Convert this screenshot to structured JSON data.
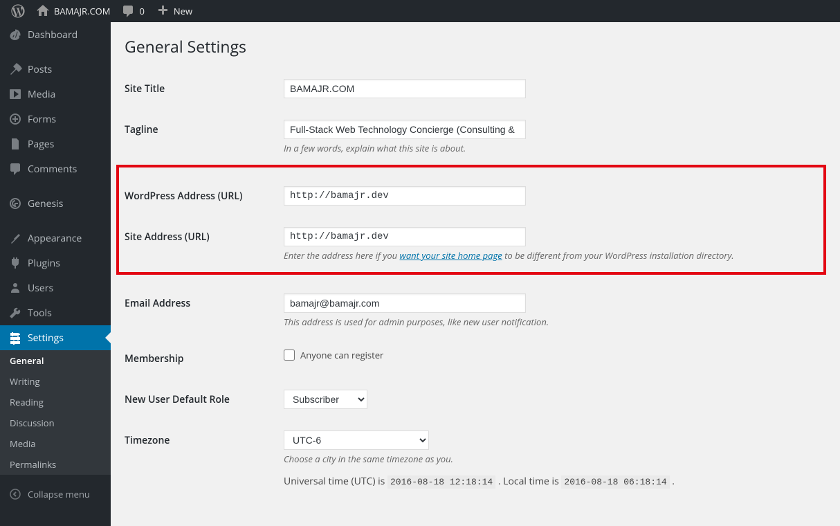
{
  "adminbar": {
    "site_name": "BAMAJR.COM",
    "comments_count": "0",
    "new_label": "New"
  },
  "sidebar": {
    "items": [
      {
        "label": "Dashboard"
      },
      {
        "label": "Posts"
      },
      {
        "label": "Media"
      },
      {
        "label": "Forms"
      },
      {
        "label": "Pages"
      },
      {
        "label": "Comments"
      },
      {
        "label": "Genesis"
      },
      {
        "label": "Appearance"
      },
      {
        "label": "Plugins"
      },
      {
        "label": "Users"
      },
      {
        "label": "Tools"
      },
      {
        "label": "Settings"
      }
    ],
    "submenu": [
      {
        "label": "General"
      },
      {
        "label": "Writing"
      },
      {
        "label": "Reading"
      },
      {
        "label": "Discussion"
      },
      {
        "label": "Media"
      },
      {
        "label": "Permalinks"
      }
    ],
    "collapse_label": "Collapse menu"
  },
  "page": {
    "title": "General Settings"
  },
  "fields": {
    "site_title": {
      "label": "Site Title",
      "value": "BAMAJR.COM"
    },
    "tagline": {
      "label": "Tagline",
      "value": "Full-Stack Web Technology Concierge (Consulting &",
      "desc": "In a few words, explain what this site is about."
    },
    "wp_url": {
      "label": "WordPress Address (URL)",
      "value": "http://bamajr.dev"
    },
    "site_url": {
      "label": "Site Address (URL)",
      "value": "http://bamajr.dev",
      "desc_pre": "Enter the address here if you ",
      "desc_link": "want your site home page",
      "desc_post": " to be different from your WordPress installation directory."
    },
    "email": {
      "label": "Email Address",
      "value": "bamajr@bamajr.com",
      "desc": "This address is used for admin purposes, like new user notification."
    },
    "membership": {
      "label": "Membership",
      "checkbox_label": "Anyone can register"
    },
    "default_role": {
      "label": "New User Default Role",
      "value": "Subscriber"
    },
    "timezone": {
      "label": "Timezone",
      "value": "UTC-6",
      "desc": "Choose a city in the same timezone as you.",
      "utc_pre": "Universal time (UTC) is ",
      "utc_time": "2016-08-18 12:18:14",
      "local_pre": " . Local time is ",
      "local_time": "2016-08-18 06:18:14",
      "suffix": " ."
    }
  }
}
